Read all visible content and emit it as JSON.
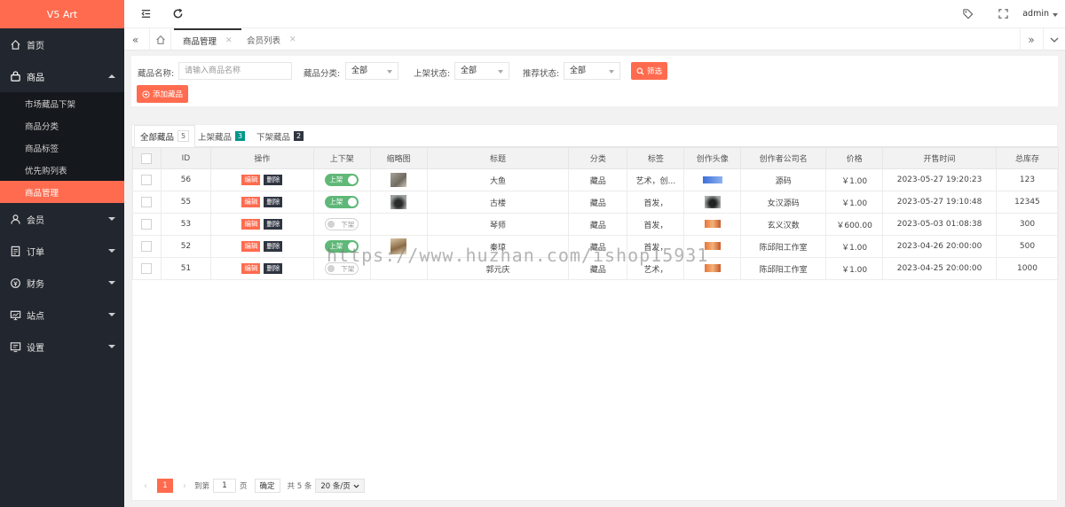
{
  "sidebar": {
    "logo": "V5 Art",
    "items": [
      {
        "label": "首页",
        "icon": "home-icon"
      },
      {
        "label": "商品",
        "icon": "bag-icon"
      },
      {
        "label": "会员",
        "icon": "user-icon"
      },
      {
        "label": "订单",
        "icon": "order-icon"
      },
      {
        "label": "财务",
        "icon": "finance-icon"
      },
      {
        "label": "站点",
        "icon": "site-icon"
      },
      {
        "label": "设置",
        "icon": "settings-icon"
      }
    ],
    "sub_items": [
      "市场藏品下架",
      "商品分类",
      "商品标签",
      "优先购列表",
      "商品管理"
    ]
  },
  "topbar": {
    "user": "admin"
  },
  "tabs": [
    {
      "label": "商品管理"
    },
    {
      "label": "会员列表"
    }
  ],
  "filter": {
    "name_label": "藏品名称:",
    "name_placeholder": "请输入商品名称",
    "category_label": "藏品分类:",
    "category_value": "全部",
    "shelf_label": "上架状态:",
    "shelf_value": "全部",
    "recommend_label": "推荐状态:",
    "recommend_value": "全部",
    "search_label": "筛选",
    "add_label": "添加藏品"
  },
  "content_tabs": [
    {
      "label": "全部藏品",
      "count": "5"
    },
    {
      "label": "上架藏品",
      "count": "3"
    },
    {
      "label": "下架藏品",
      "count": "2"
    }
  ],
  "table": {
    "headers": [
      "ID",
      "操作",
      "上下架",
      "缩略图",
      "标题",
      "分类",
      "标签",
      "创作头像",
      "创作者公司名",
      "价格",
      "开售时间",
      "总库存"
    ],
    "edit_label": "编辑",
    "delete_label": "删除",
    "on_label": "上架",
    "off_label": "下架",
    "rows": [
      {
        "id": "56",
        "status": "on",
        "title": "大鱼",
        "category": "藏品",
        "tags": "艺术，创...",
        "company": "源码",
        "price": "￥1.00",
        "time": "2023-05-27 19:20:23",
        "stock": "123"
      },
      {
        "id": "55",
        "status": "on",
        "title": "古楼",
        "category": "藏品",
        "tags": "首发，",
        "company": "女汉源码",
        "price": "￥1.00",
        "time": "2023-05-27 19:10:48",
        "stock": "12345"
      },
      {
        "id": "53",
        "status": "off",
        "title": "琴师",
        "category": "藏品",
        "tags": "首发，",
        "company": "玄义汉数",
        "price": "￥600.00",
        "time": "2023-05-03 01:08:38",
        "stock": "300"
      },
      {
        "id": "52",
        "status": "on",
        "title": "秦琼",
        "category": "藏品",
        "tags": "首发，",
        "company": "陈邱阳工作室",
        "price": "￥1.00",
        "time": "2023-04-26 20:00:00",
        "stock": "500"
      },
      {
        "id": "51",
        "status": "off",
        "title": "郭元庆",
        "category": "藏品",
        "tags": "艺术，",
        "company": "陈邱阳工作室",
        "price": "￥1.00",
        "time": "2023-04-25 20:00:00",
        "stock": "1000"
      }
    ]
  },
  "pager": {
    "current": "1",
    "goto_label": "到第",
    "page_input": "1",
    "page_suffix": "页",
    "confirm": "确定",
    "total": "共 5 条",
    "page_size": "20 条/页"
  },
  "watermark": "https://www.huzhan.com/ishop15931",
  "colors": {
    "accent": "#ff6b4e",
    "sidebar": "#22262e",
    "switch_on": "#5fb878",
    "badge_all": "#999999",
    "badge_on": "#009688",
    "badge_off": "#2f3540"
  }
}
